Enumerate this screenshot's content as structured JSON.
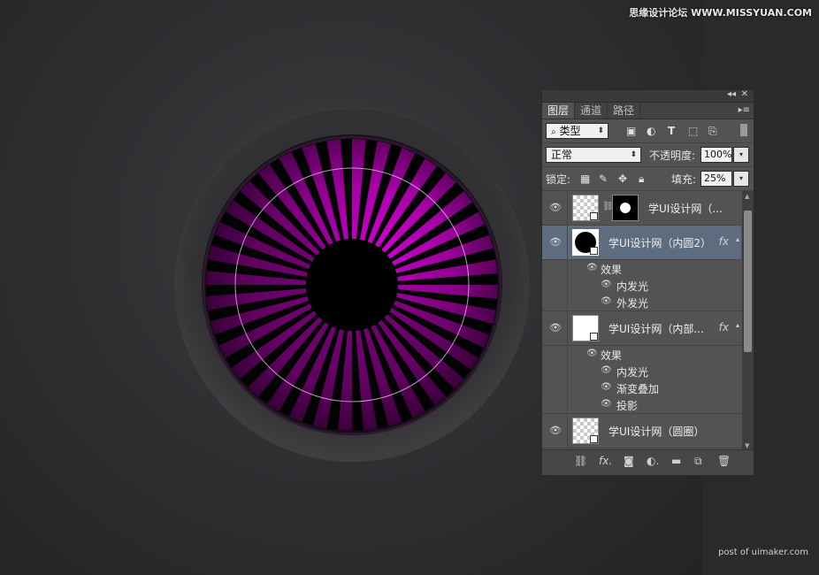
{
  "watermark_top": "思缘设计论坛 WWW.MISSYUAN.COM",
  "watermark_bottom": "post of uimaker.com",
  "panel": {
    "tabs": [
      {
        "label": "图层",
        "active": true
      },
      {
        "label": "通道",
        "active": false
      },
      {
        "label": "路径",
        "active": false
      }
    ],
    "filter_kind": "类型",
    "blend_mode": "正常",
    "opacity_label": "不透明度:",
    "opacity_value": "100%",
    "lock_label": "锁定:",
    "fill_label": "填充:",
    "fill_value": "25%",
    "layers": [
      {
        "name": "学UI设计网（...",
        "visible": true,
        "has_mask": true,
        "selected": false
      },
      {
        "name": "学UI设计网（内圆2）",
        "visible": true,
        "fx": "fx",
        "selected": true,
        "effects_label": "效果",
        "effects": [
          "内发光",
          "外发光"
        ]
      },
      {
        "name": "学UI设计网（内部...",
        "visible": true,
        "fx": "fx",
        "selected": false,
        "effects_label": "效果",
        "effects": [
          "内发光",
          "渐变叠加",
          "投影"
        ]
      },
      {
        "name": "学UI设计网（圆圈）",
        "visible": true,
        "selected": false
      }
    ]
  },
  "colors": {
    "accent_magenta": "#e600e6",
    "panel_bg": "#535353",
    "selected_layer": "#5e6c80"
  }
}
